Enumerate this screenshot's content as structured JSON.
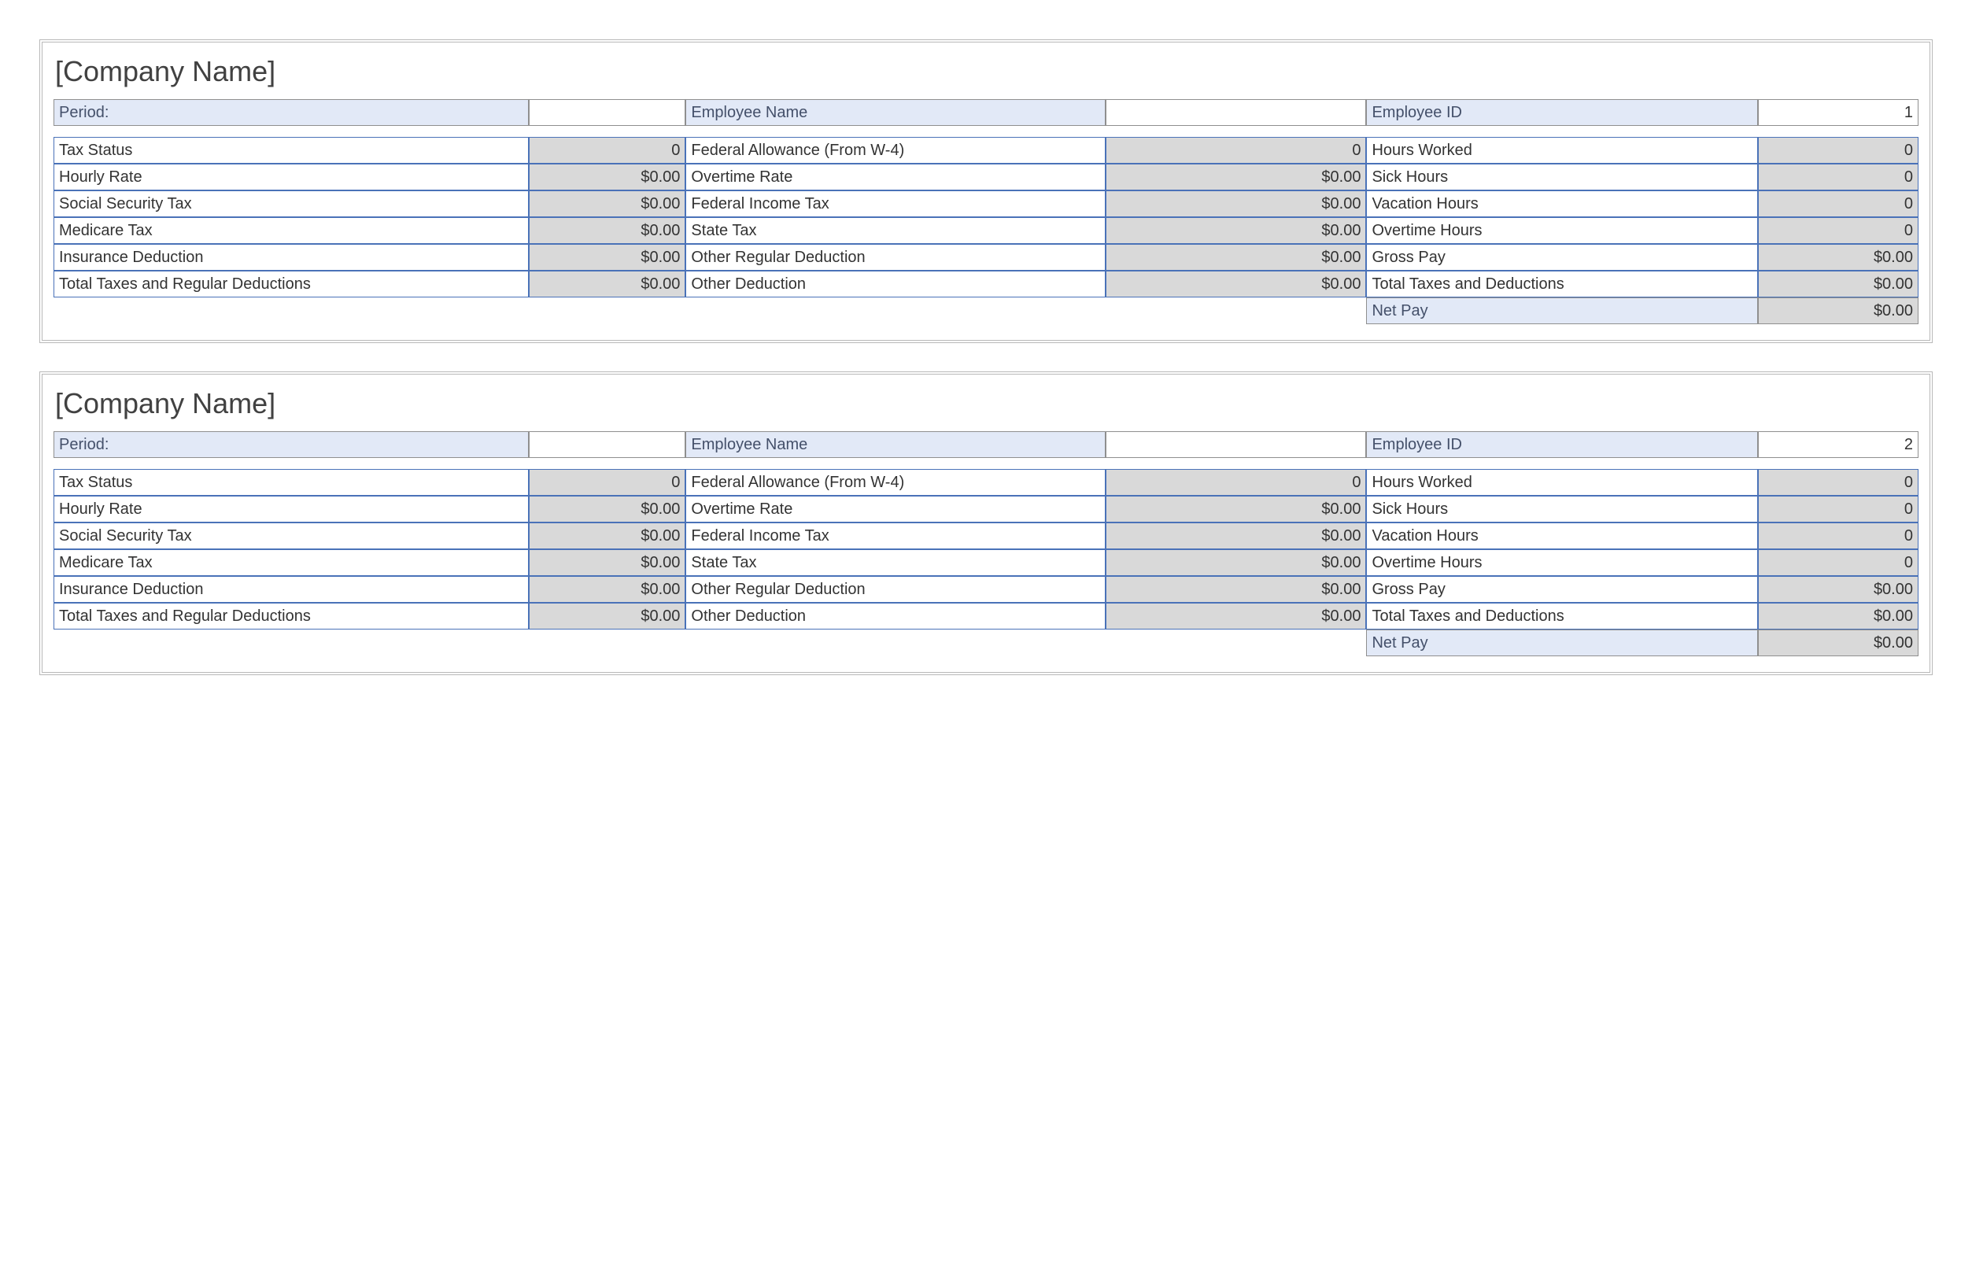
{
  "stubs": [
    {
      "company": "[Company Name]",
      "header": {
        "period_label": "Period:",
        "period_value": "",
        "emp_name_label": "Employee Name",
        "emp_name_value": "",
        "emp_id_label": "Employee ID",
        "emp_id_value": "1"
      },
      "rows": [
        {
          "l1": "Tax Status",
          "v1": "0",
          "l2": "Federal Allowance (From W-4)",
          "v2": "0",
          "l3": "Hours Worked",
          "v3": "0"
        },
        {
          "l1": "Hourly Rate",
          "v1": "$0.00",
          "l2": "Overtime Rate",
          "v2": "$0.00",
          "l3": "Sick Hours",
          "v3": "0"
        },
        {
          "l1": "Social Security Tax",
          "v1": "$0.00",
          "l2": "Federal Income Tax",
          "v2": "$0.00",
          "l3": "Vacation Hours",
          "v3": "0"
        },
        {
          "l1": "Medicare Tax",
          "v1": "$0.00",
          "l2": "State Tax",
          "v2": "$0.00",
          "l3": "Overtime Hours",
          "v3": "0"
        },
        {
          "l1": "Insurance Deduction",
          "v1": "$0.00",
          "l2": "Other Regular Deduction",
          "v2": "$0.00",
          "l3": "Gross Pay",
          "v3": "$0.00"
        },
        {
          "l1": "Total Taxes and Regular Deductions",
          "v1": "$0.00",
          "l2": "Other Deduction",
          "v2": "$0.00",
          "l3": "Total Taxes and Deductions",
          "v3": "$0.00"
        }
      ],
      "net": {
        "label": "Net Pay",
        "value": "$0.00"
      }
    },
    {
      "company": "[Company Name]",
      "header": {
        "period_label": "Period:",
        "period_value": "",
        "emp_name_label": "Employee Name",
        "emp_name_value": "",
        "emp_id_label": "Employee ID",
        "emp_id_value": "2"
      },
      "rows": [
        {
          "l1": "Tax Status",
          "v1": "0",
          "l2": "Federal Allowance (From W-4)",
          "v2": "0",
          "l3": "Hours Worked",
          "v3": "0"
        },
        {
          "l1": "Hourly Rate",
          "v1": "$0.00",
          "l2": "Overtime Rate",
          "v2": "$0.00",
          "l3": "Sick Hours",
          "v3": "0"
        },
        {
          "l1": "Social Security Tax",
          "v1": "$0.00",
          "l2": "Federal Income Tax",
          "v2": "$0.00",
          "l3": "Vacation Hours",
          "v3": "0"
        },
        {
          "l1": "Medicare Tax",
          "v1": "$0.00",
          "l2": "State Tax",
          "v2": "$0.00",
          "l3": "Overtime Hours",
          "v3": "0"
        },
        {
          "l1": "Insurance Deduction",
          "v1": "$0.00",
          "l2": "Other Regular Deduction",
          "v2": "$0.00",
          "l3": "Gross Pay",
          "v3": "$0.00"
        },
        {
          "l1": "Total Taxes and Regular Deductions",
          "v1": "$0.00",
          "l2": "Other Deduction",
          "v2": "$0.00",
          "l3": "Total Taxes and Deductions",
          "v3": "$0.00"
        }
      ],
      "net": {
        "label": "Net Pay",
        "value": "$0.00"
      }
    }
  ]
}
